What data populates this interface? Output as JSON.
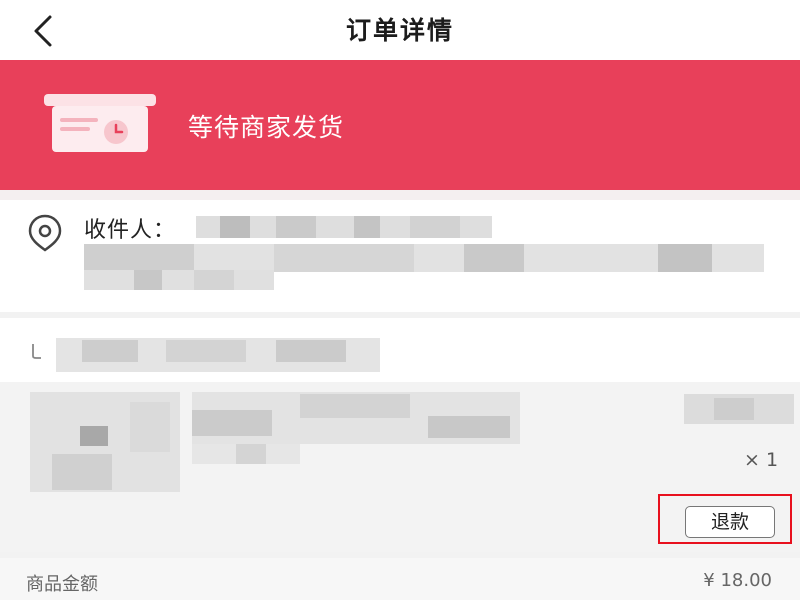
{
  "header": {
    "title": "订单详情",
    "back_icon": "chevron-left-icon"
  },
  "status_banner": {
    "text": "等待商家发货",
    "icon": "box-clock-icon",
    "background_color": "#e8405a"
  },
  "address": {
    "recipient_label": "收件人：",
    "icon": "location-pin-icon"
  },
  "store": {
    "icon": "store-icon"
  },
  "product": {
    "quantity": "× 1",
    "refund_button_label": "退款",
    "highlight_color": "#e8101e"
  },
  "summary": {
    "label": "商品金额",
    "value": "¥ 18.00"
  }
}
